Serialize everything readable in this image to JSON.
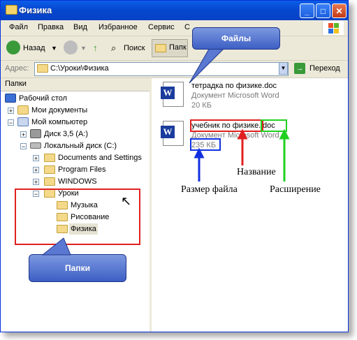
{
  "window": {
    "title": "Физика",
    "minimize": "_",
    "maximize": "□",
    "close": "✕"
  },
  "menu": {
    "items": [
      "Файл",
      "Правка",
      "Вид",
      "Избранное",
      "Сервис",
      "С"
    ]
  },
  "toolbar": {
    "back": "Назад",
    "search": "Поиск",
    "folders": "Папк"
  },
  "address": {
    "label": "Адрес:",
    "value": "C:\\Уроки\\Физика",
    "go": "Переход"
  },
  "left_pane": {
    "title": "Папки",
    "tree": [
      {
        "label": "Рабочий стол",
        "icon": "desktop-icon"
      },
      {
        "label": "Мои документы",
        "icon": "my-documents-icon"
      },
      {
        "label": "Мой компьютер",
        "icon": "my-computer-icon"
      },
      {
        "label": "Диск 3,5 (A:)",
        "icon": "floppy-icon"
      },
      {
        "label": "Локальный диск (C:)",
        "icon": "local-disk-icon"
      },
      {
        "label": "Documents and Settings",
        "icon": "folder-icon"
      },
      {
        "label": "Program Files",
        "icon": "folder-icon"
      },
      {
        "label": "WINDOWS",
        "icon": "folder-icon"
      },
      {
        "label": "Уроки",
        "icon": "folder-open-icon"
      },
      {
        "label": "Музыка",
        "icon": "folder-icon"
      },
      {
        "label": "Рисование",
        "icon": "folder-icon"
      },
      {
        "label": "Физика",
        "icon": "folder-icon"
      }
    ]
  },
  "files": [
    {
      "name": "тетрадка по физике.doc",
      "type": "Документ Microsoft Word",
      "size": "20 КБ"
    },
    {
      "name_base": "учебник по физике.",
      "name_ext": "doc",
      "type": "Документ Microsoft Word",
      "size": "235 КБ"
    }
  ],
  "annotations": {
    "files_callout": "Файлы",
    "folders_callout": "Папки",
    "name_label": "Название",
    "size_label": "Размер файла",
    "ext_label": "Расширение"
  },
  "colors": {
    "name": "#e02020",
    "size": "#1030e0",
    "ext": "#20d020"
  }
}
